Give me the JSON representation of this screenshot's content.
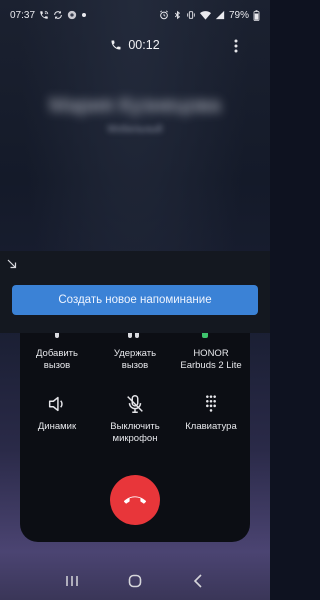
{
  "status_bar": {
    "time": "07:37",
    "battery_percent": "79%",
    "left_icons": [
      "phone-call-icon",
      "sync-icon",
      "app-icon",
      "dot-icon"
    ],
    "right_icons": [
      "alarm-icon",
      "bluetooth-icon",
      "vibrate-icon",
      "wifi-icon",
      "signal-icon",
      "battery-icon"
    ]
  },
  "call": {
    "timer": "00:12",
    "caller_name": "Мария Кузнецова",
    "caller_sub": "Мобильный"
  },
  "reminder": {
    "button_label": "Создать новое напоминание"
  },
  "controls": {
    "add_call": "Добавить\nвызов",
    "hold_call": "Удержать\nвызов",
    "bluetooth_device": "HONOR\nEarbuds 2 Lite",
    "speaker": "Динамик",
    "mute": "Выключить\nмикрофон",
    "keypad": "Клавиатура"
  },
  "colors": {
    "accent_blue": "#3b82d6",
    "end_call_red": "#e8363a",
    "bluetooth_green": "#3ec46d"
  }
}
